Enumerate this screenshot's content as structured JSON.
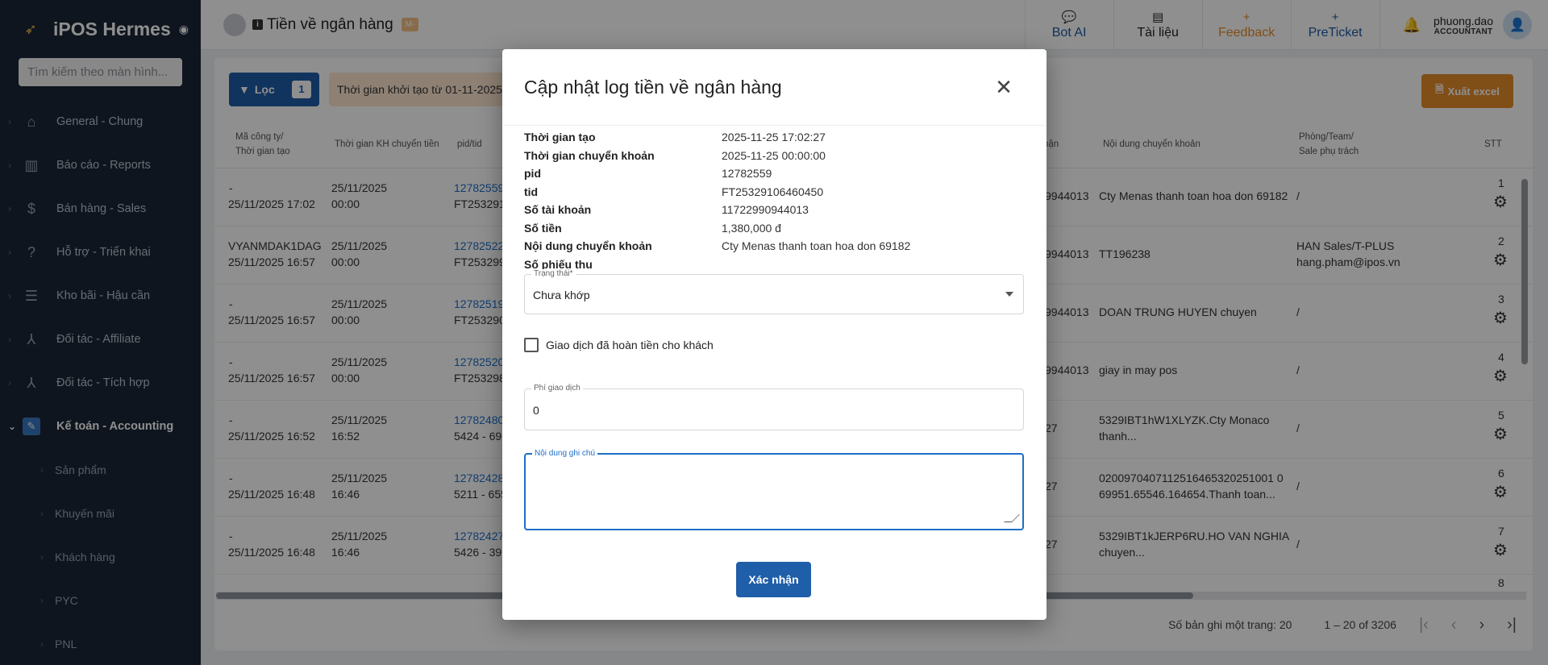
{
  "sidebar": {
    "brand": "iPOS Hermes",
    "search_placeholder": "Tìm kiếm theo màn hình...",
    "items": [
      {
        "label": "General - Chung",
        "icon": "home-icon"
      },
      {
        "label": "Báo cáo - Reports",
        "icon": "chart-icon"
      },
      {
        "label": "Bán hàng - Sales",
        "icon": "dollar-icon"
      },
      {
        "label": "Hỗ trợ - Triển khai",
        "icon": "help-icon"
      },
      {
        "label": "Kho bãi - Hậu cần",
        "icon": "list-icon"
      },
      {
        "label": "Đối tác - Affiliate",
        "icon": "network-icon"
      },
      {
        "label": "Đối tác - Tích hợp",
        "icon": "network-icon"
      },
      {
        "label": "Kế toán - Accounting",
        "icon": "accounting-icon",
        "active": true
      }
    ],
    "subitems": [
      "Sản phẩm",
      "Khuyến mãi",
      "Khách hàng",
      "PYC",
      "PNL"
    ]
  },
  "header": {
    "title": "Tiền về ngân hàng",
    "badge": "M-",
    "buttons": [
      {
        "label": "Bot AI",
        "icon": "chat-icon"
      },
      {
        "label": "Tài liệu",
        "icon": "book-icon"
      },
      {
        "label": "Feedback",
        "icon": "plus-icon"
      },
      {
        "label": "PreTicket",
        "icon": "plus-icon"
      }
    ],
    "user": {
      "name": "phuong.dao",
      "role": "ACCOUNTANT"
    }
  },
  "toolbar": {
    "filter_label": "Lọc",
    "filter_count": "1",
    "filter_chip": "Thời gian khởi tạo từ 01-11-2025 đ",
    "export_label": "Xuất excel"
  },
  "table": {
    "headers": {
      "company": "Mã công ty/",
      "created": "Thời gian tạo",
      "transfer_time": "Thời gian KH chuyển tiền",
      "pid_tid": "pid/tid",
      "receiver": "hận",
      "content": "Nội dung chuyển khoản",
      "team": "Phòng/Team/",
      "sale": "Sale phụ trách",
      "stt": "STT"
    },
    "rows": [
      {
        "company": "-",
        "created": "25/11/2025 17:02",
        "t1": "25/11/2025",
        "t2": "00:00",
        "pid": "12782559",
        "tid": "FT253291",
        "acct": "9944013",
        "content1": "Cty Menas thanh toan hoa don 69182",
        "content2": "",
        "team1": "/",
        "team2": "",
        "stt": "1"
      },
      {
        "company": "VYANMDAK1DAG",
        "created": "25/11/2025 16:57",
        "t1": "25/11/2025",
        "t2": "00:00",
        "pid": "12782522",
        "tid": "FT253299",
        "acct": "9944013",
        "content1": "TT196238",
        "content2": "",
        "team1": "HAN Sales/T-PLUS",
        "team2": "hang.pham@ipos.vn",
        "stt": "2"
      },
      {
        "company": "-",
        "created": "25/11/2025 16:57",
        "t1": "25/11/2025",
        "t2": "00:00",
        "pid": "12782519",
        "tid": "FT253290",
        "acct": "9944013",
        "content1": "DOAN TRUNG HUYEN chuyen",
        "content2": "",
        "team1": "/",
        "team2": "",
        "stt": "3"
      },
      {
        "company": "-",
        "created": "25/11/2025 16:57",
        "t1": "25/11/2025",
        "t2": "00:00",
        "pid": "12782520",
        "tid": "FT253298",
        "acct": "9944013",
        "content1": "giay in may pos",
        "content2": "",
        "team1": "/",
        "team2": "",
        "stt": "4"
      },
      {
        "company": "-",
        "created": "25/11/2025 16:52",
        "t1": "25/11/2025",
        "t2": "16:52",
        "pid": "12782480",
        "tid": "5424 - 696",
        "acct": "27",
        "content1": "5329IBT1hW1XLYZK.Cty Monaco",
        "content2": "thanh...",
        "team1": "/",
        "team2": "",
        "stt": "5"
      },
      {
        "company": "-",
        "created": "25/11/2025 16:48",
        "t1": "25/11/2025",
        "t2": "16:46",
        "pid": "12782428",
        "tid": "5211 - 655",
        "acct": "27",
        "content1": "0200970407112516465320251001 0",
        "content2": "69951.65546.164654.Thanh toan...",
        "team1": "/",
        "team2": "",
        "stt": "6"
      },
      {
        "company": "-",
        "created": "25/11/2025 16:48",
        "t1": "25/11/2025",
        "t2": "16:46",
        "pid": "12782427",
        "tid": "5426 - 397",
        "acct": "27",
        "content1": "5329IBT1kJERP6RU.HO VAN NGHIA",
        "content2": "chuyen...",
        "team1": "/",
        "team2": "",
        "stt": "7"
      }
    ],
    "partial_stt": "8"
  },
  "pager": {
    "per_page": "Số bản ghi một trang: 20",
    "range": "1 – 20 of 3206"
  },
  "modal": {
    "title": "Cập nhật log tiền về ngân hàng",
    "info": [
      {
        "k": "Thời gian tạo",
        "v": "2025-11-25 17:02:27"
      },
      {
        "k": "Thời gian chuyển khoản",
        "v": "2025-11-25 00:00:00"
      },
      {
        "k": "pid",
        "v": "12782559"
      },
      {
        "k": "tid",
        "v": "FT25329106460450"
      },
      {
        "k": "Số tài khoản",
        "v": "11722990944013"
      },
      {
        "k": "Số tiền",
        "v": "1,380,000 đ"
      },
      {
        "k": "Nội dung chuyển khoản",
        "v": "Cty Menas thanh toan hoa don 69182"
      },
      {
        "k": "Số phiếu thu",
        "v": ""
      }
    ],
    "status_label": "Trạng thái*",
    "status_value": "Chưa khớp",
    "refund_label": "Giao dịch đã hoàn tiền cho khách",
    "refund_checked": false,
    "fee_label": "Phí giao dịch",
    "fee_value": "0",
    "note_label": "Nội dung ghi chú",
    "note_value": "",
    "confirm_label": "Xác nhận"
  }
}
